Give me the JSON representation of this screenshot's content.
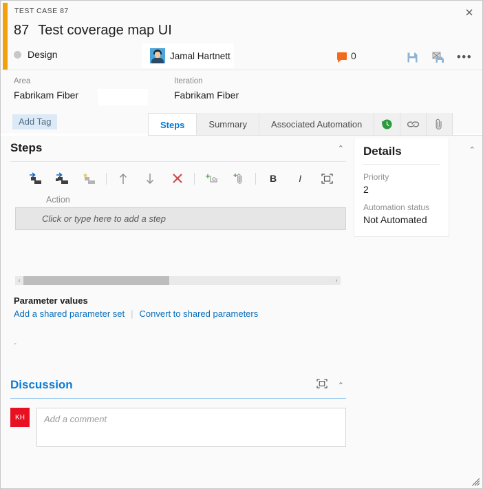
{
  "window": {
    "breadcrumb": "TEST CASE 87",
    "close_label": "✕",
    "accent_color": "#f2a00c"
  },
  "header": {
    "work_item_id": "87",
    "title": "Test coverage map UI",
    "state": "Design",
    "assignee": "Jamal Hartnett",
    "comment_count": "0",
    "actions": {
      "save": "save-icon",
      "save_and_close": "save-and-close-icon",
      "more": "•••"
    }
  },
  "fields": {
    "area_label": "Area",
    "area_value": "Fabrikam Fiber",
    "iteration_label": "Iteration",
    "iteration_value": "Fabrikam Fiber",
    "add_tag": "Add Tag"
  },
  "tabs": [
    {
      "label": "Steps",
      "active": true
    },
    {
      "label": "Summary",
      "active": false
    },
    {
      "label": "Associated Automation",
      "active": false
    }
  ],
  "icon_tabs": [
    {
      "name": "history-icon",
      "glyph": "◔"
    },
    {
      "name": "link-icon",
      "glyph": "🔗"
    },
    {
      "name": "attachment-icon",
      "glyph": "📎"
    }
  ],
  "steps": {
    "title": "Steps",
    "collapse": "⌃",
    "toolbar": [
      {
        "name": "insert-step-icon",
        "enabled": true
      },
      {
        "name": "insert-shared-steps-icon",
        "enabled": true
      },
      {
        "name": "create-shared-step-icon",
        "enabled": false
      },
      {
        "name": "move-up-icon",
        "glyph": "↑",
        "enabled": true
      },
      {
        "name": "move-down-icon",
        "glyph": "↓",
        "enabled": true
      },
      {
        "name": "delete-step-icon",
        "glyph": "✕",
        "enabled": true
      },
      {
        "name": "add-parameter-icon",
        "enabled": true
      },
      {
        "name": "attach-file-icon",
        "enabled": true
      },
      {
        "name": "bold-icon",
        "glyph": "B",
        "enabled": true
      },
      {
        "name": "italic-icon",
        "glyph": "I",
        "enabled": true
      },
      {
        "name": "expand-icon",
        "enabled": true
      }
    ],
    "column_action": "Action",
    "placeholder": "Click or type here to add a step",
    "scroll_left": "‹",
    "scroll_right": "›"
  },
  "parameters": {
    "title": "Parameter values",
    "add_link": "Add a shared parameter set",
    "divider": "|",
    "convert_link": "Convert to shared parameters",
    "empty_value": "-"
  },
  "discussion": {
    "title": "Discussion",
    "expand": "expand-icon",
    "collapse": "⌃",
    "avatar_initials": "KH",
    "comment_placeholder": "Add a comment"
  },
  "details": {
    "title": "Details",
    "collapse": "⌃",
    "priority_label": "Priority",
    "priority_value": "2",
    "automation_label": "Automation status",
    "automation_value": "Not Automated"
  }
}
